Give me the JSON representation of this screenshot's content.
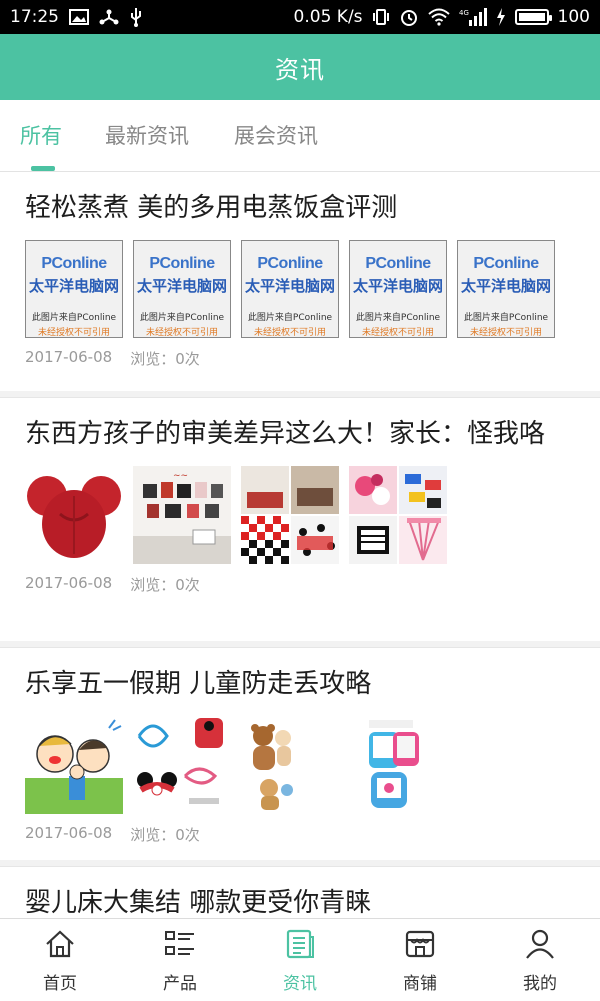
{
  "status_bar": {
    "time": "17:25",
    "speed": "0.05 K/s",
    "network": "4G",
    "battery_level": 100,
    "battery_text": "100"
  },
  "header": {
    "title": "资讯"
  },
  "tabs": [
    {
      "label": "所有",
      "active": true
    },
    {
      "label": "最新资讯",
      "active": false
    },
    {
      "label": "展会资讯",
      "active": false
    }
  ],
  "articles": [
    {
      "title": "轻松蒸煮 美的多用电蒸饭盒评测",
      "date": "2017-06-08",
      "views": "浏览：0次",
      "thumb_watermark": {
        "logo": "PConline",
        "cn": "太平洋电脑网",
        "line1": "此图片来自PConline",
        "line2": "未经授权不可引用"
      }
    },
    {
      "title": "东西方孩子的审美差异这么大！家长：怪我咯",
      "date": "2017-06-08",
      "views": "浏览：0次"
    },
    {
      "title": "乐享五一假期 儿童防走丢攻略",
      "date": "2017-06-08",
      "views": "浏览：0次"
    },
    {
      "title": "婴儿床大集结 哪款更受你青睐"
    }
  ],
  "bottom_nav": [
    {
      "label": "首页",
      "icon": "home-icon"
    },
    {
      "label": "产品",
      "icon": "list-icon"
    },
    {
      "label": "资讯",
      "icon": "news-icon",
      "active": true
    },
    {
      "label": "商铺",
      "icon": "shop-icon"
    },
    {
      "label": "我的",
      "icon": "user-icon"
    }
  ],
  "colors": {
    "accent": "#4cc2a2",
    "text": "#1e1e1e",
    "muted": "#9a9a9a"
  }
}
